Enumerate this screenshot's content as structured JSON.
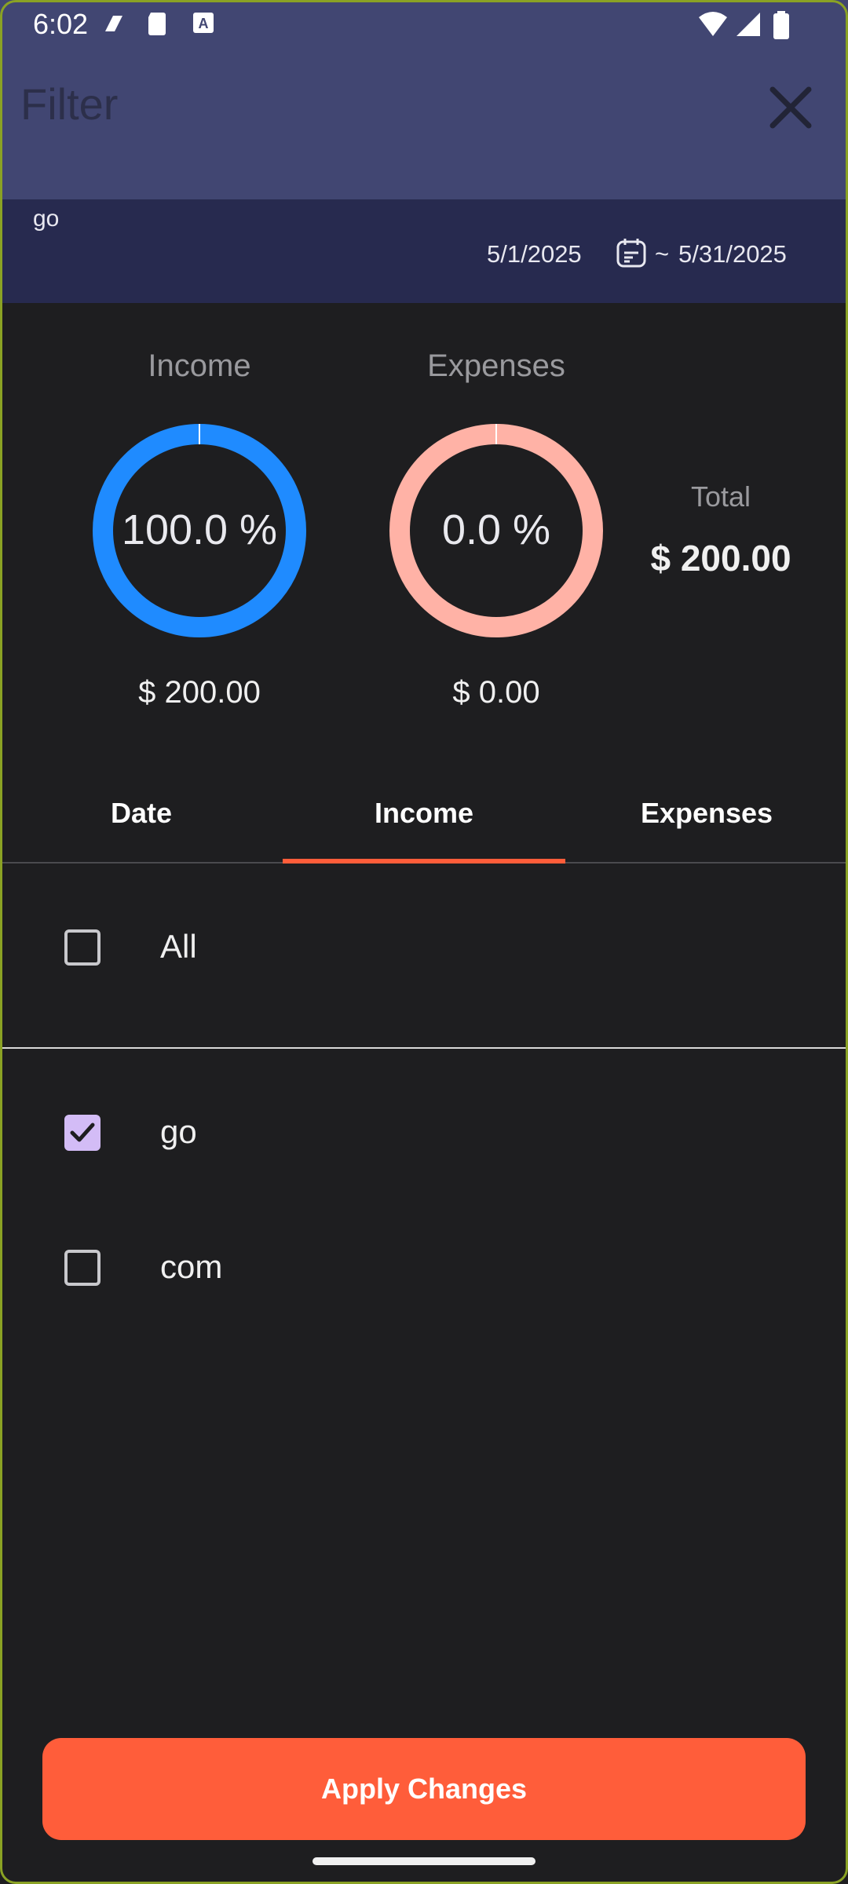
{
  "status_bar": {
    "time": "6:02"
  },
  "app_bar": {
    "title": "Filter"
  },
  "date_range": {
    "label": "go",
    "start": "5/1/2025",
    "separator": "~",
    "end": "5/31/2025"
  },
  "summary": {
    "income": {
      "label": "Income",
      "percent_text": "100.0 %",
      "percent": 100.0,
      "amount": "$ 200.00",
      "color": "#1f8bff"
    },
    "expenses": {
      "label": "Expenses",
      "percent_text": "0.0 %",
      "percent": 0.0,
      "amount": "$ 0.00",
      "color": "#ffb2a6"
    },
    "total": {
      "label": "Total",
      "amount": "$ 200.00"
    }
  },
  "tabs": [
    {
      "label": "Date",
      "selected": false
    },
    {
      "label": "Income",
      "selected": true
    },
    {
      "label": "Expenses",
      "selected": false
    }
  ],
  "list": {
    "all": {
      "label": "All",
      "checked": false
    },
    "items": [
      {
        "label": "go",
        "checked": true
      },
      {
        "label": "com",
        "checked": false
      }
    ]
  },
  "apply_button": {
    "label": "Apply Changes"
  },
  "colors": {
    "accent": "#ff5d3a",
    "header": "#414672",
    "date_strip": "#272a4f",
    "background": "#1e1e20",
    "check": "#d3bcf6"
  }
}
